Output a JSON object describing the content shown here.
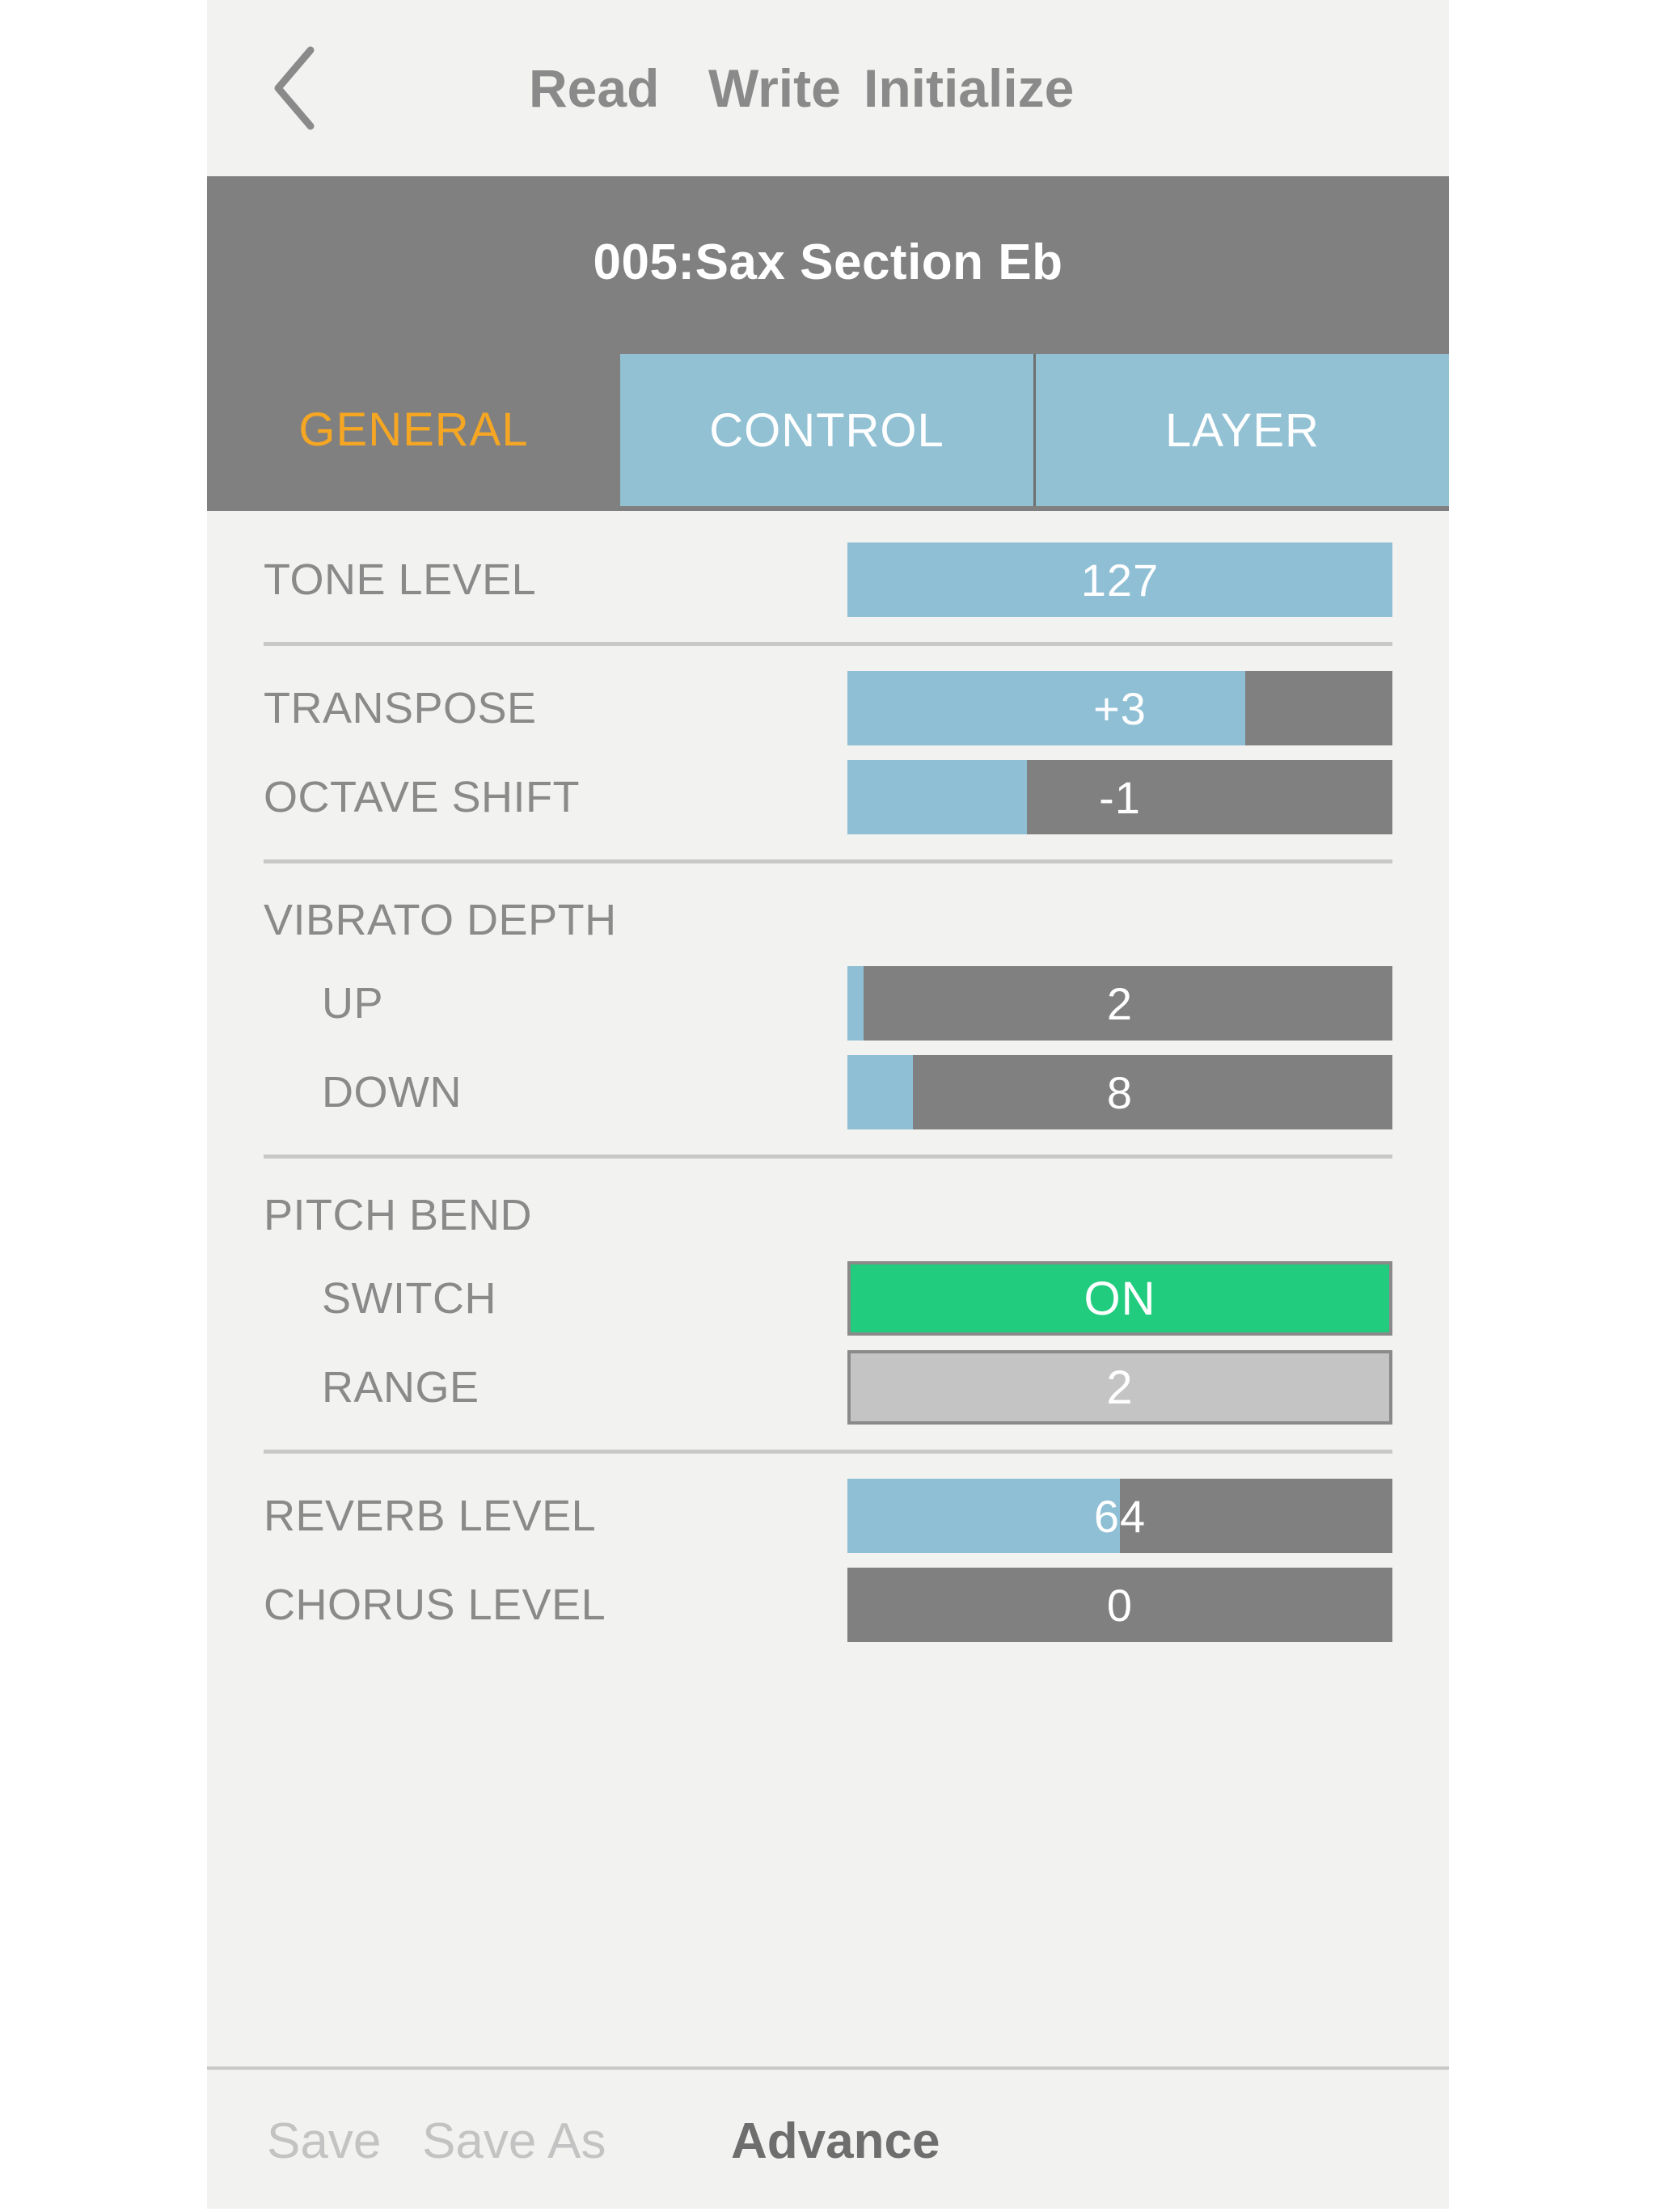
{
  "topnav": {
    "back_icon": "chevron-left-icon",
    "items": [
      {
        "label": "Read"
      },
      {
        "label": "Write"
      },
      {
        "label": "Initialize"
      }
    ]
  },
  "header": {
    "title": "005:Sax Section Eb"
  },
  "tabs": [
    {
      "label": "GENERAL",
      "active": true
    },
    {
      "label": "CONTROL",
      "active": false
    },
    {
      "label": "LAYER",
      "active": false
    }
  ],
  "params": {
    "tone_level": {
      "label": "TONE LEVEL",
      "value": "127",
      "fill_pct": 100
    },
    "transpose": {
      "label": "TRANSPOSE",
      "value": "+3",
      "fill_pct": 73
    },
    "octave_shift": {
      "label": "OCTAVE SHIFT",
      "value": "-1",
      "fill_pct": 33
    },
    "vibrato_depth": {
      "label": "VIBRATO DEPTH",
      "up": {
        "label": "UP",
        "value": "2",
        "fill_pct": 3
      },
      "down": {
        "label": "DOWN",
        "value": "8",
        "fill_pct": 12
      }
    },
    "pitch_bend": {
      "label": "PITCH BEND",
      "switch": {
        "label": "SWITCH",
        "value": "ON",
        "state": "on"
      },
      "range": {
        "label": "RANGE",
        "value": "2",
        "state": "off"
      }
    },
    "reverb_level": {
      "label": "REVERB LEVEL",
      "value": "64",
      "fill_pct": 50
    },
    "chorus_level": {
      "label": "CHORUS LEVEL",
      "value": "0",
      "fill_pct": 0
    }
  },
  "bottombar": {
    "save": "Save",
    "save_as": "Save As",
    "advance": "Advance"
  },
  "colors": {
    "accent_blue": "#8FBFD4",
    "tab_blue": "#92C1D4",
    "track_gray": "#808080",
    "active_tab_text": "#F5A623",
    "switch_on_green": "#22CC7E",
    "page_bg": "#F2F2F0"
  }
}
